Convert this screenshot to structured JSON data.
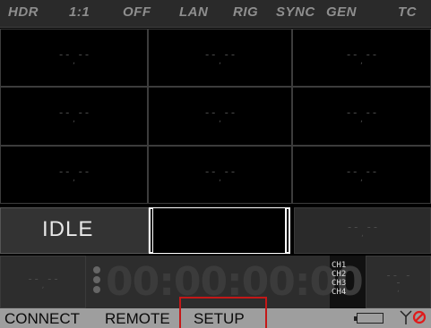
{
  "status_bar": {
    "items": [
      "HDR",
      "1:1",
      "OFF",
      "LAN",
      "RIG",
      "SYNC",
      "GEN",
      "TC"
    ]
  },
  "grid": {
    "placeholder_main": "-- --",
    "placeholder_sub": ","
  },
  "state": {
    "label": "IDLE"
  },
  "timecode": {
    "value": "00:00:00:00",
    "channels": [
      "CH1",
      "CH2",
      "CH3",
      "CH4"
    ]
  },
  "menu": {
    "items": [
      "CONNECT",
      "REMOTE",
      "SETUP"
    ],
    "selected": "SETUP"
  },
  "colors": {
    "highlight": "#c41818",
    "no_signal": "#e01b1b"
  },
  "icons": {
    "battery": "battery-icon",
    "antenna": "antenna-icon",
    "no_signal": "no-signal-icon"
  }
}
